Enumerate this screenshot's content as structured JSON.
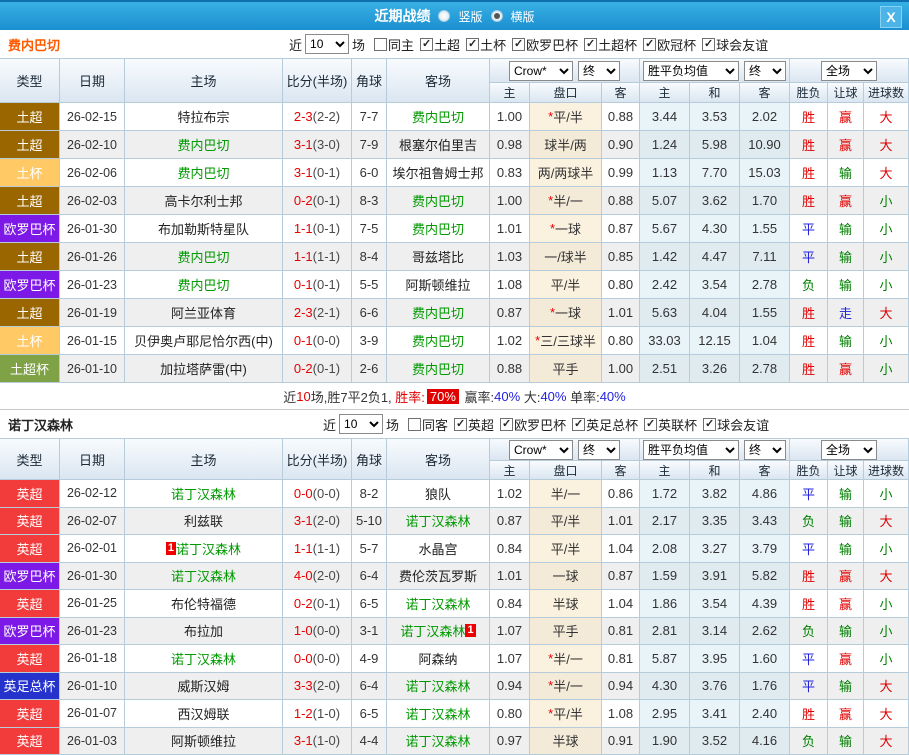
{
  "colors": {
    "red": "#e10000",
    "blue": "#2222dd",
    "green": "#008000",
    "subject_team": "#009900"
  },
  "titlebar": {
    "title": "近期战绩",
    "radios": [
      {
        "label": "竖版",
        "selected": false
      },
      {
        "label": "横版",
        "selected": true
      }
    ],
    "close": "X"
  },
  "sections": [
    {
      "team": "费内巴切",
      "team_color": "#ff5a00",
      "filter": {
        "prefix": "近",
        "count": "10",
        "suffix": "场",
        "same": {
          "label": "同主",
          "checked": false
        },
        "leagues": [
          {
            "label": "土超",
            "checked": true
          },
          {
            "label": "土杯",
            "checked": true
          },
          {
            "label": "欧罗巴杯",
            "checked": true
          },
          {
            "label": "土超杯",
            "checked": true
          },
          {
            "label": "欧冠杯",
            "checked": true
          },
          {
            "label": "球会友谊",
            "checked": true
          }
        ]
      },
      "table": {
        "headers": {
          "type": "类型",
          "date": "日期",
          "home": "主场",
          "score": "比分(半场)",
          "corner": "角球",
          "away": "客场",
          "odds_home": "主",
          "handicap": "盘口",
          "odds_away": "客",
          "avg_home": "主",
          "avg_draw": "和",
          "avg_away": "客",
          "result": "胜负",
          "handicap_result": "让球",
          "goals": "进球数"
        },
        "dropdowns": {
          "company": "Crow*",
          "final1": "终",
          "avg": "胜平负均值",
          "final2": "终",
          "scope": "全场"
        },
        "rows": [
          {
            "type": "土超",
            "type_color": "#996600",
            "date": "26-02-15",
            "home": "特拉布宗",
            "home_subject": false,
            "score_ft": "2-3",
            "score_ht": "(2-2)",
            "corner": "7-7",
            "away": "费内巴切",
            "away_subject": true,
            "odds_home": "1.00",
            "handicap": "*平/半",
            "odds_away": "0.88",
            "avg_home": "3.44",
            "avg_draw": "3.53",
            "avg_away": "2.02",
            "result": "胜",
            "handicap_result": "赢",
            "goals": "大"
          },
          {
            "type": "土超",
            "type_color": "#996600",
            "date": "26-02-10",
            "home": "费内巴切",
            "home_subject": true,
            "score_ft": "3-1",
            "score_ht": "(3-0)",
            "corner": "7-9",
            "away": "根塞尔伯里吉",
            "away_subject": false,
            "odds_home": "0.98",
            "handicap": "球半/两",
            "odds_away": "0.90",
            "avg_home": "1.24",
            "avg_draw": "5.98",
            "avg_away": "10.90",
            "result": "胜",
            "handicap_result": "赢",
            "goals": "大"
          },
          {
            "type": "土杯",
            "type_color": "#ffc966",
            "date": "26-02-06",
            "home": "费内巴切",
            "home_subject": true,
            "score_ft": "3-1",
            "score_ht": "(0-1)",
            "corner": "6-0",
            "away": "埃尔祖鲁姆士邦",
            "away_subject": false,
            "odds_home": "0.83",
            "handicap": "两/两球半",
            "odds_away": "0.99",
            "avg_home": "1.13",
            "avg_draw": "7.70",
            "avg_away": "15.03",
            "result": "胜",
            "handicap_result": "输",
            "goals": "大"
          },
          {
            "type": "土超",
            "type_color": "#996600",
            "date": "26-02-03",
            "home": "高卡尔利士邦",
            "home_subject": false,
            "score_ft": "0-2",
            "score_ht": "(0-1)",
            "corner": "8-3",
            "away": "费内巴切",
            "away_subject": true,
            "odds_home": "1.00",
            "handicap": "*半/一",
            "odds_away": "0.88",
            "avg_home": "5.07",
            "avg_draw": "3.62",
            "avg_away": "1.70",
            "result": "胜",
            "handicap_result": "赢",
            "goals": "小"
          },
          {
            "type": "欧罗巴杯",
            "type_color": "#7d19e6",
            "date": "26-01-30",
            "home": "布加勒斯特星队",
            "home_subject": false,
            "score_ft": "1-1",
            "score_ht": "(0-1)",
            "corner": "7-5",
            "away": "费内巴切",
            "away_subject": true,
            "odds_home": "1.01",
            "handicap": "*一球",
            "odds_away": "0.87",
            "avg_home": "5.67",
            "avg_draw": "4.30",
            "avg_away": "1.55",
            "result": "平",
            "handicap_result": "输",
            "goals": "小"
          },
          {
            "type": "土超",
            "type_color": "#996600",
            "date": "26-01-26",
            "home": "费内巴切",
            "home_subject": true,
            "score_ft": "1-1",
            "score_ht": "(1-1)",
            "corner": "8-4",
            "away": "哥兹塔比",
            "away_subject": false,
            "odds_home": "1.03",
            "handicap": "一/球半",
            "odds_away": "0.85",
            "avg_home": "1.42",
            "avg_draw": "4.47",
            "avg_away": "7.11",
            "result": "平",
            "handicap_result": "输",
            "goals": "小"
          },
          {
            "type": "欧罗巴杯",
            "type_color": "#7d19e6",
            "date": "26-01-23",
            "home": "费内巴切",
            "home_subject": true,
            "score_ft": "0-1",
            "score_ht": "(0-1)",
            "corner": "5-5",
            "away": "阿斯顿维拉",
            "away_subject": false,
            "odds_home": "1.08",
            "handicap": "平/半",
            "odds_away": "0.80",
            "avg_home": "2.42",
            "avg_draw": "3.54",
            "avg_away": "2.78",
            "result": "负",
            "handicap_result": "输",
            "goals": "小"
          },
          {
            "type": "土超",
            "type_color": "#996600",
            "date": "26-01-19",
            "home": "阿兰亚体育",
            "home_subject": false,
            "score_ft": "2-3",
            "score_ht": "(2-1)",
            "corner": "6-6",
            "away": "费内巴切",
            "away_subject": true,
            "odds_home": "0.87",
            "handicap": "*一球",
            "odds_away": "1.01",
            "avg_home": "5.63",
            "avg_draw": "4.04",
            "avg_away": "1.55",
            "result": "胜",
            "handicap_result": "走",
            "goals": "大"
          },
          {
            "type": "土杯",
            "type_color": "#ffc966",
            "date": "26-01-15",
            "home": "贝伊奥卢耶尼恰尔西(中)",
            "home_subject": false,
            "score_ft": "0-1",
            "score_ht": "(0-0)",
            "corner": "3-9",
            "away": "费内巴切",
            "away_subject": true,
            "odds_home": "1.02",
            "handicap": "*三/三球半",
            "odds_away": "0.80",
            "avg_home": "33.03",
            "avg_draw": "12.15",
            "avg_away": "1.04",
            "result": "胜",
            "handicap_result": "输",
            "goals": "小"
          },
          {
            "type": "土超杯",
            "type_color": "#7fa246",
            "date": "26-01-10",
            "home": "加拉塔萨雷(中)",
            "home_subject": false,
            "score_ft": "0-2",
            "score_ht": "(0-1)",
            "corner": "2-6",
            "away": "费内巴切",
            "away_subject": true,
            "odds_home": "0.88",
            "handicap": "平手",
            "odds_away": "1.00",
            "avg_home": "2.51",
            "avg_draw": "3.26",
            "avg_away": "2.78",
            "result": "胜",
            "handicap_result": "赢",
            "goals": "小"
          }
        ]
      },
      "summary": {
        "parts": [
          {
            "t": "近",
            "c": "#333333"
          },
          {
            "t": "10",
            "c": "#e10000"
          },
          {
            "t": "场,胜7平2负1, ",
            "c": "#333333"
          },
          {
            "t": "胜率:",
            "c": "#e10000"
          },
          {
            "t": "70%",
            "c": "#ffffff",
            "bg": "#e10000"
          },
          {
            "t": " 赢率:",
            "c": "#333333"
          },
          {
            "t": "40%",
            "c": "#2222dd"
          },
          {
            "t": " 大:",
            "c": "#333333"
          },
          {
            "t": "40%",
            "c": "#2222dd"
          },
          {
            "t": " 单率:",
            "c": "#333333"
          },
          {
            "t": "40%",
            "c": "#2222dd"
          }
        ]
      }
    },
    {
      "team": "诺丁汉森林",
      "team_color": "#222222",
      "filter": {
        "prefix": "近",
        "count": "10",
        "suffix": "场",
        "same": {
          "label": "同客",
          "checked": false
        },
        "leagues": [
          {
            "label": "英超",
            "checked": true
          },
          {
            "label": "欧罗巴杯",
            "checked": true
          },
          {
            "label": "英足总杯",
            "checked": true
          },
          {
            "label": "英联杯",
            "checked": true
          },
          {
            "label": "球会友谊",
            "checked": true
          }
        ]
      },
      "table": {
        "headers": {
          "type": "类型",
          "date": "日期",
          "home": "主场",
          "score": "比分(半场)",
          "corner": "角球",
          "away": "客场",
          "odds_home": "主",
          "handicap": "盘口",
          "odds_away": "客",
          "avg_home": "主",
          "avg_draw": "和",
          "avg_away": "客",
          "result": "胜负",
          "handicap_result": "让球",
          "goals": "进球数"
        },
        "dropdowns": {
          "company": "Crow*",
          "final1": "终",
          "avg": "胜平负均值",
          "final2": "终",
          "scope": "全场"
        },
        "rows": [
          {
            "type": "英超",
            "type_color": "#f23b3b",
            "date": "26-02-12",
            "home": "诺丁汉森林",
            "home_subject": true,
            "score_ft": "0-0",
            "score_ht": "(0-0)",
            "corner": "8-2",
            "away": "狼队",
            "away_subject": false,
            "odds_home": "1.02",
            "handicap": "半/一",
            "odds_away": "0.86",
            "avg_home": "1.72",
            "avg_draw": "3.82",
            "avg_away": "4.86",
            "result": "平",
            "handicap_result": "输",
            "goals": "小"
          },
          {
            "type": "英超",
            "type_color": "#f23b3b",
            "date": "26-02-07",
            "home": "利兹联",
            "home_subject": false,
            "score_ft": "3-1",
            "score_ht": "(2-0)",
            "corner": "5-10",
            "away": "诺丁汉森林",
            "away_subject": true,
            "odds_home": "0.87",
            "handicap": "平/半",
            "odds_away": "1.01",
            "avg_home": "2.17",
            "avg_draw": "3.35",
            "avg_away": "3.43",
            "result": "负",
            "handicap_result": "输",
            "goals": "大"
          },
          {
            "type": "英超",
            "type_color": "#f23b3b",
            "date": "26-02-01",
            "home": "诺丁汉森林",
            "home_subject": true,
            "home_card": "1",
            "home_card_pos": "pre",
            "score_ft": "1-1",
            "score_ht": "(1-1)",
            "corner": "5-7",
            "away": "水晶宫",
            "away_subject": false,
            "odds_home": "0.84",
            "handicap": "平/半",
            "odds_away": "1.04",
            "avg_home": "2.08",
            "avg_draw": "3.27",
            "avg_away": "3.79",
            "result": "平",
            "handicap_result": "输",
            "goals": "小"
          },
          {
            "type": "欧罗巴杯",
            "type_color": "#7d19e6",
            "date": "26-01-30",
            "home": "诺丁汉森林",
            "home_subject": true,
            "score_ft": "4-0",
            "score_ht": "(2-0)",
            "corner": "6-4",
            "away": "费伦茨瓦罗斯",
            "away_subject": false,
            "odds_home": "1.01",
            "handicap": "一球",
            "odds_away": "0.87",
            "avg_home": "1.59",
            "avg_draw": "3.91",
            "avg_away": "5.82",
            "result": "胜",
            "handicap_result": "赢",
            "goals": "大"
          },
          {
            "type": "英超",
            "type_color": "#f23b3b",
            "date": "26-01-25",
            "home": "布伦特福德",
            "home_subject": false,
            "score_ft": "0-2",
            "score_ht": "(0-1)",
            "corner": "6-5",
            "away": "诺丁汉森林",
            "away_subject": true,
            "odds_home": "0.84",
            "handicap": "半球",
            "odds_away": "1.04",
            "avg_home": "1.86",
            "avg_draw": "3.54",
            "avg_away": "4.39",
            "result": "胜",
            "handicap_result": "赢",
            "goals": "小"
          },
          {
            "type": "欧罗巴杯",
            "type_color": "#7d19e6",
            "date": "26-01-23",
            "home": "布拉加",
            "home_subject": false,
            "score_ft": "1-0",
            "score_ht": "(0-0)",
            "corner": "3-1",
            "away": "诺丁汉森林",
            "away_subject": true,
            "away_card": "1",
            "away_card_pos": "post",
            "odds_home": "1.07",
            "handicap": "平手",
            "odds_away": "0.81",
            "avg_home": "2.81",
            "avg_draw": "3.14",
            "avg_away": "2.62",
            "result": "负",
            "handicap_result": "输",
            "goals": "小"
          },
          {
            "type": "英超",
            "type_color": "#f23b3b",
            "date": "26-01-18",
            "home": "诺丁汉森林",
            "home_subject": true,
            "score_ft": "0-0",
            "score_ht": "(0-0)",
            "corner": "4-9",
            "away": "阿森纳",
            "away_subject": false,
            "odds_home": "1.07",
            "handicap": "*半/一",
            "odds_away": "0.81",
            "avg_home": "5.87",
            "avg_draw": "3.95",
            "avg_away": "1.60",
            "result": "平",
            "handicap_result": "赢",
            "goals": "小"
          },
          {
            "type": "英足总杯",
            "type_color": "#2533cc",
            "date": "26-01-10",
            "home": "威斯汉姆",
            "home_subject": false,
            "score_ft": "3-3",
            "score_ht": "(2-0)",
            "corner": "6-4",
            "away": "诺丁汉森林",
            "away_subject": true,
            "odds_home": "0.94",
            "handicap": "*半/一",
            "odds_away": "0.94",
            "avg_home": "4.30",
            "avg_draw": "3.76",
            "avg_away": "1.76",
            "result": "平",
            "handicap_result": "输",
            "goals": "大"
          },
          {
            "type": "英超",
            "type_color": "#f23b3b",
            "date": "26-01-07",
            "home": "西汉姆联",
            "home_subject": false,
            "score_ft": "1-2",
            "score_ht": "(1-0)",
            "corner": "6-5",
            "away": "诺丁汉森林",
            "away_subject": true,
            "odds_home": "0.80",
            "handicap": "*平/半",
            "odds_away": "1.08",
            "avg_home": "2.95",
            "avg_draw": "3.41",
            "avg_away": "2.40",
            "result": "胜",
            "handicap_result": "赢",
            "goals": "大"
          },
          {
            "type": "英超",
            "type_color": "#f23b3b",
            "date": "26-01-03",
            "home": "阿斯顿维拉",
            "home_subject": false,
            "score_ft": "3-1",
            "score_ht": "(1-0)",
            "corner": "4-4",
            "away": "诺丁汉森林",
            "away_subject": true,
            "odds_home": "0.97",
            "handicap": "半球",
            "odds_away": "0.91",
            "avg_home": "1.90",
            "avg_draw": "3.52",
            "avg_away": "4.16",
            "result": "负",
            "handicap_result": "输",
            "goals": "大"
          }
        ]
      }
    }
  ]
}
